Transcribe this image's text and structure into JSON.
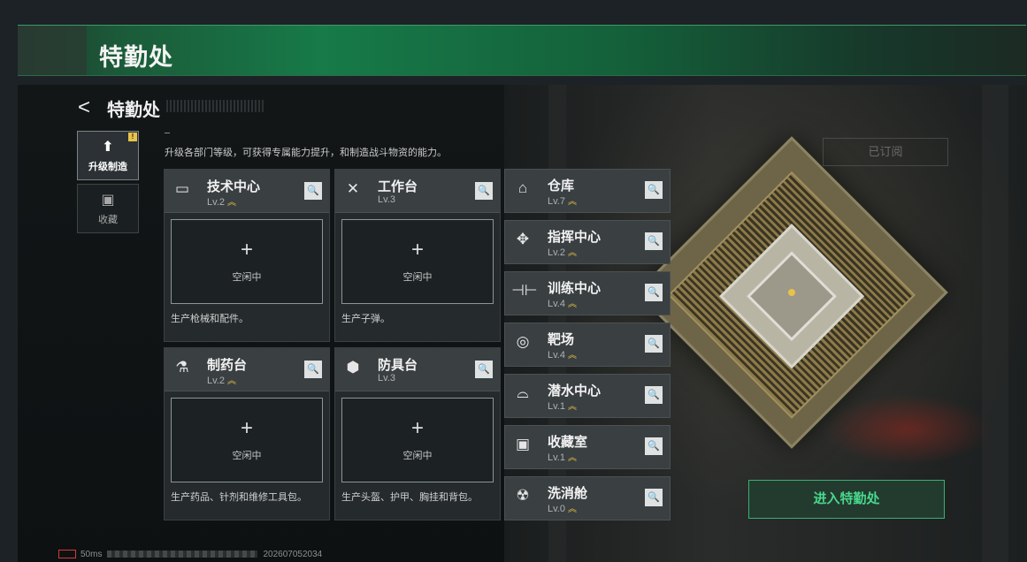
{
  "banner": {
    "title": "特勤处"
  },
  "header": {
    "back_glyph": "<",
    "title": "特勤处",
    "description": "升级各部门等级，可获得专属能力提升，和制造战斗物资的能力。"
  },
  "sidebar": {
    "tabs": [
      {
        "label": "升级制造",
        "icon": "upgrade-icon",
        "glyph": "⬆",
        "badge": "!"
      },
      {
        "label": "收藏",
        "icon": "collection-icon",
        "glyph": "▣"
      }
    ]
  },
  "cards": [
    {
      "name": "技术中心",
      "level": "Lv.2",
      "icon": "monitor-icon",
      "glyph": "▭",
      "slot_plus": "+",
      "slot_status": "空闲中",
      "desc": "生产枪械和配件。"
    },
    {
      "name": "工作台",
      "level": "Lv.3",
      "icon": "tools-icon",
      "glyph": "✕",
      "slot_plus": "+",
      "slot_status": "空闲中",
      "desc": "生产子弹。"
    },
    {
      "name": "制药台",
      "level": "Lv.2",
      "icon": "microscope-icon",
      "glyph": "⚗",
      "slot_plus": "+",
      "slot_status": "空闲中",
      "desc": "生产药品、针剂和维修工具包。"
    },
    {
      "name": "防具台",
      "level": "Lv.3",
      "icon": "armor-icon",
      "glyph": "⬢",
      "slot_plus": "+",
      "slot_status": "空闲中",
      "desc": "生产头盔、护甲、胸挂和背包。"
    }
  ],
  "facilities": [
    {
      "name": "仓库",
      "level": "Lv.7",
      "icon": "warehouse-icon",
      "glyph": "⌂"
    },
    {
      "name": "指挥中心",
      "level": "Lv.2",
      "icon": "command-icon",
      "glyph": "✥"
    },
    {
      "name": "训练中心",
      "level": "Lv.4",
      "icon": "dumbbell-icon",
      "glyph": "⊣⊢"
    },
    {
      "name": "靶场",
      "level": "Lv.4",
      "icon": "target-icon",
      "glyph": "◎"
    },
    {
      "name": "潜水中心",
      "level": "Lv.1",
      "icon": "diving-icon",
      "glyph": "⌓"
    },
    {
      "name": "收藏室",
      "level": "Lv.1",
      "icon": "vault-icon",
      "glyph": "▣"
    },
    {
      "name": "洗消舱",
      "level": "Lv.0",
      "icon": "decontam-icon",
      "glyph": "☢"
    }
  ],
  "level_up_glyph": "︽",
  "search_glyph": "🔍",
  "right_panel": {
    "subscribed_label": "已订阅",
    "enter_button": "进入特勤处"
  },
  "status_bar": {
    "ping": "50ms",
    "build": "202607052034"
  },
  "colors": {
    "accent": "#48d78b",
    "banner": "#177a48",
    "level_up": "#e8c24a"
  }
}
